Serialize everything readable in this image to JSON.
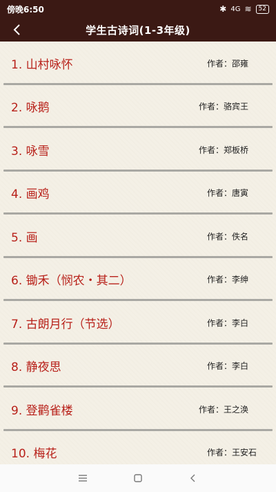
{
  "status_bar": {
    "time": "傍晚6:50",
    "signal": "4G",
    "battery": "52"
  },
  "app_bar": {
    "title": "学生古诗词(1-3年级)",
    "back_icon": "back-chevron-icon"
  },
  "poems": [
    {
      "title": "1.  山村咏怀",
      "author": "作者：邵雍"
    },
    {
      "title": "2.  咏鹅",
      "author": "作者：骆宾王"
    },
    {
      "title": "3.  咏雪",
      "author": "作者：郑板桥"
    },
    {
      "title": "4.  画鸡",
      "author": "作者：唐寅"
    },
    {
      "title": "5.  画",
      "author": "作者：佚名"
    },
    {
      "title": "6.  锄禾（悯农・其二）",
      "author": "作者：李绅"
    },
    {
      "title": "7.  古朗月行（节选）",
      "author": "作者：李白"
    },
    {
      "title": "8.  静夜思",
      "author": "作者：李白"
    },
    {
      "title": "9.  登鹳雀楼",
      "author": "作者：王之涣"
    },
    {
      "title": "10.  梅花",
      "author": "作者：王安石"
    }
  ],
  "nav_bar": {
    "icons": [
      "menu-icon",
      "home-icon",
      "back-icon"
    ]
  },
  "colors": {
    "header_bg": "#3b1914",
    "title_red": "#b8211a",
    "divider": "#a9a8a3"
  }
}
